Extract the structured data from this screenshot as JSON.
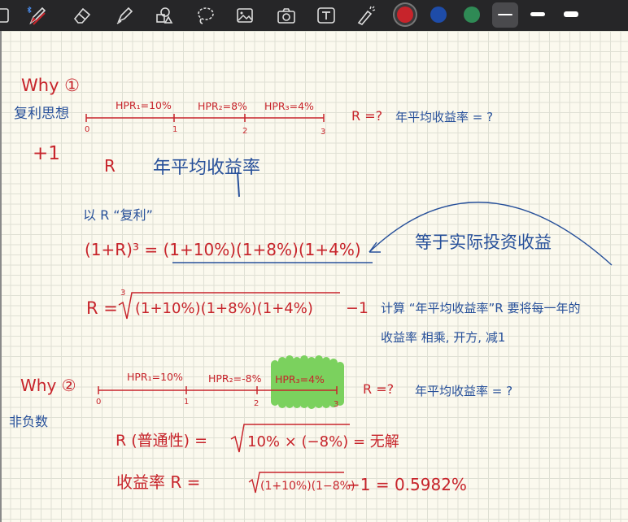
{
  "toolbar": {
    "tools": [
      "document-icon",
      "pen-icon",
      "eraser-icon",
      "highlighter-icon",
      "shapes-icon",
      "lasso-icon",
      "image-icon",
      "camera-icon",
      "text-icon",
      "laser-pointer-icon"
    ],
    "colors": [
      "#c7242b",
      "#1e4ca8",
      "#2f8a55"
    ],
    "selected_color": "#c7242b"
  },
  "note": {
    "why1_label": "Why ①",
    "why1_sub": "复利思想",
    "plus1": "+1",
    "timeline1": {
      "hpr": [
        "HPR₁=10%",
        "HPR₂=8%",
        "HPR₃=4%"
      ],
      "ticks": [
        "0",
        "1",
        "2",
        "3"
      ]
    },
    "q1_r": "R =?",
    "q1_text": "年平均收益率 = ?",
    "r_letter": "R",
    "annual_avg": "年平均收益率",
    "with_r": "以 R “复利”",
    "eq1": "(1+R)³ = (1+10%)(1+8%)(1+4%)",
    "eq1_note": "等于实际投资收益",
    "eq2_left": "R =",
    "eq2_root_index": "3",
    "eq2_body": "(1+10%)(1+8%)(1+4%)",
    "eq2_tail": "−1",
    "calc_note_1": "计算 “年平均收益率”R 要将每一年的",
    "calc_note_2": "收益率 相乘, 开方, 减1",
    "why2_label": "Why ②",
    "why2_sub": "非负数",
    "timeline2": {
      "hpr": [
        "HPR₁=10%",
        "HPR₂=-8%",
        "HPR₃=4%"
      ],
      "ticks": [
        "0",
        "1",
        "2",
        "3"
      ]
    },
    "q2_r": "R =?",
    "q2_text": "年平均收益率 = ?",
    "eq3_left": "R (普通性) =",
    "eq3_body": "10% × (−8%) = 无解",
    "eq4_left": "收益率  R  =",
    "eq4_body": "(1+10%)(1−8%)",
    "eq4_tail": "−1 = 0.5982%"
  }
}
